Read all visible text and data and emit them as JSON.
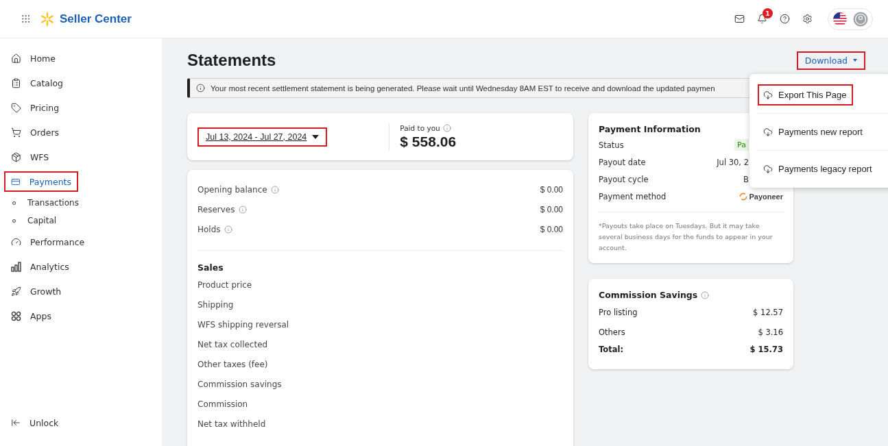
{
  "header": {
    "brand": "Seller Center",
    "notification_count": "1"
  },
  "sidebar": {
    "items": [
      {
        "label": "Home",
        "selected": false,
        "highlighted": false
      },
      {
        "label": "Catalog",
        "selected": false,
        "highlighted": false
      },
      {
        "label": "Pricing",
        "selected": false,
        "highlighted": false
      },
      {
        "label": "Orders",
        "selected": false,
        "highlighted": false
      },
      {
        "label": "WFS",
        "selected": false,
        "highlighted": false
      },
      {
        "label": "Payments",
        "selected": true,
        "highlighted": true,
        "children": [
          {
            "label": "Transactions",
            "selected": false
          },
          {
            "label": "Capital",
            "selected": false
          }
        ]
      },
      {
        "label": "Performance",
        "selected": false,
        "highlighted": false
      },
      {
        "label": "Analytics",
        "selected": false,
        "highlighted": false
      },
      {
        "label": "Growth",
        "selected": false,
        "highlighted": false
      },
      {
        "label": "Apps",
        "selected": false,
        "highlighted": false
      }
    ],
    "footer": "Unlock"
  },
  "page": {
    "title": "Statements",
    "download": {
      "label": "Download",
      "highlighted": true
    },
    "notice": "Your most recent settlement statement is being generated. Please wait until Wednesday 8AM EST to receive and download the updated paymen"
  },
  "download_menu": [
    {
      "label": "Export This Page",
      "highlighted": true
    },
    {
      "label": "Payments new report",
      "highlighted": false
    },
    {
      "label": "Payments legacy report",
      "highlighted": false
    }
  ],
  "period": {
    "range": "Jul 13, 2024 - Jul 27, 2024",
    "highlighted": true,
    "paid_label": "Paid to you",
    "paid_amount": "$ 558.06"
  },
  "balances": [
    {
      "label": "Opening balance",
      "value": "$ 0.00"
    },
    {
      "label": "Reserves",
      "value": "$ 0.00"
    },
    {
      "label": "Holds",
      "value": "$ 0.00"
    }
  ],
  "sales": {
    "title": "Sales",
    "rows": [
      "Product price",
      "Shipping",
      "WFS shipping reversal",
      "Net tax collected",
      "Other taxes (fee)",
      "Commission savings",
      "Commission",
      "Net tax withheld"
    ]
  },
  "payment_info": {
    "title": "Payment Information",
    "rows": [
      {
        "label": "Status",
        "value": "Pa",
        "kind": "badge"
      },
      {
        "label": "Payout date",
        "value": "Jul 30, 2",
        "kind": "text"
      },
      {
        "label": "Payout cycle",
        "value": "B",
        "kind": "text"
      },
      {
        "label": "Payment method",
        "value": "Payoneer",
        "kind": "logo"
      }
    ],
    "note": "*Payouts take place on Tuesdays. But it may take several business days for the funds to appear in your account."
  },
  "commission_savings": {
    "title": "Commission Savings",
    "rows": [
      {
        "label": "Pro listing",
        "value": "$ 12.57",
        "total": false
      },
      {
        "label": "Others",
        "value": "$ 3.16",
        "total": false
      },
      {
        "label": "Total:",
        "value": "$ 15.73",
        "total": true
      }
    ]
  }
}
